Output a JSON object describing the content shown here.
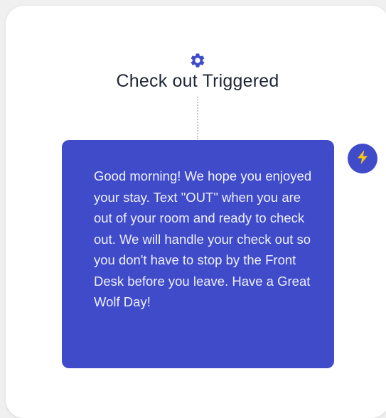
{
  "trigger": {
    "title": "Check out Triggered",
    "icon": "gear-icon"
  },
  "message": {
    "text": "Good morning! We hope you enjoyed your stay. Text \"OUT\" when you are out of your room and ready to check out. We will handle your check out so you don't have to stop by the Front Desk before you leave. Have a Great Wolf Day!"
  },
  "action": {
    "icon": "lightning-bolt-icon"
  },
  "colors": {
    "accent": "#3f4bc9",
    "bolt": "#f5c518",
    "title_text": "#1e2535",
    "message_text": "#eef0ff",
    "card_bg": "#ffffff",
    "page_bg": "#f0f0f0"
  }
}
